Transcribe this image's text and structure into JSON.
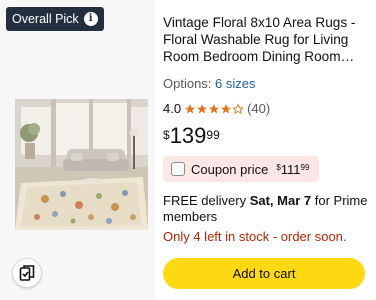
{
  "badge": {
    "label": "Overall Pick",
    "icon": "info-icon"
  },
  "product": {
    "title": "Vintage Floral 8x10 Area Rugs - Floral Washable Rug for Living Room Bedroom Dining Room Kids Nursery Non-Slip Rug",
    "options_label": "Options:",
    "options_link": "6 sizes",
    "rating": "4.0",
    "rating_value": 4.0,
    "rating_count": "(40)",
    "price": {
      "symbol": "$",
      "whole": "139",
      "fraction": "99"
    },
    "coupon": {
      "label": "Coupon price",
      "symbol": "$",
      "whole": "111",
      "fraction": "99"
    },
    "delivery": {
      "prefix": "FREE delivery",
      "date": "Sat, Mar 7",
      "suffix": "for Prime members"
    },
    "stock": "Only 4 left in stock - order soon.",
    "cart_button": "Add to cart"
  },
  "colors": {
    "badge_bg": "#232f3e",
    "link": "#2162a1",
    "star": "#de7921",
    "coupon_bg": "#fde6e6",
    "stock": "#b12704",
    "cart_button": "#ffd814"
  }
}
